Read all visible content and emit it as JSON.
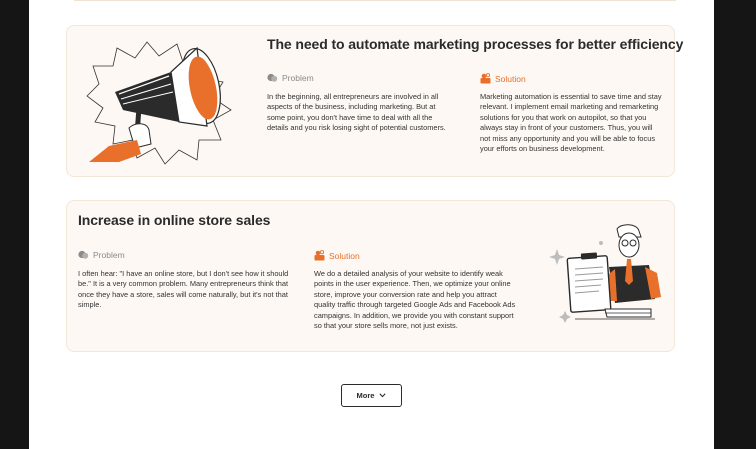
{
  "cards": [
    {
      "title": "The need to automate marketing processes for better efficiency",
      "problem_label": "Problem",
      "problem_text": "In the beginning, all entrepreneurs are involved in all aspects of the business, including marketing. But at some point, you don't have time to deal with all the details and you risk losing sight of potential customers.",
      "solution_label": "Solution",
      "solution_text": "Marketing automation is essential to save time and stay relevant. I implement email marketing and remarketing solutions for you that work on autopilot, so that you always stay in front of your customers. Thus, you will not miss any opportunity and you will be able to focus your efforts on business development.",
      "illustration": "megaphone-illustration"
    },
    {
      "title": "Increase in online store sales",
      "problem_label": "Problem",
      "problem_text": "I often hear: \"I have an online store, but I don't see how it should be.\" It is a very common problem. Many entrepreneurs think that once they have a store, sales will come naturally, but it's not that simple.",
      "solution_label": "Solution",
      "solution_text": "We do a detailed analysis of your website to identify weak points in the user experience. Then, we optimize your online store, improve your conversion rate and help you attract quality traffic through targeted Google Ads and Facebook Ads campaigns. In addition, we provide you with constant support so that your store sells more, not just exists.",
      "illustration": "man-with-clipboard-illustration"
    }
  ],
  "more_button": {
    "label": "More",
    "icon": "chevron-down-icon"
  },
  "colors": {
    "accent": "#e8702a",
    "card_bg": "#fdf8f3",
    "page_bg": "#ffffff",
    "outer_bg": "#151515"
  }
}
